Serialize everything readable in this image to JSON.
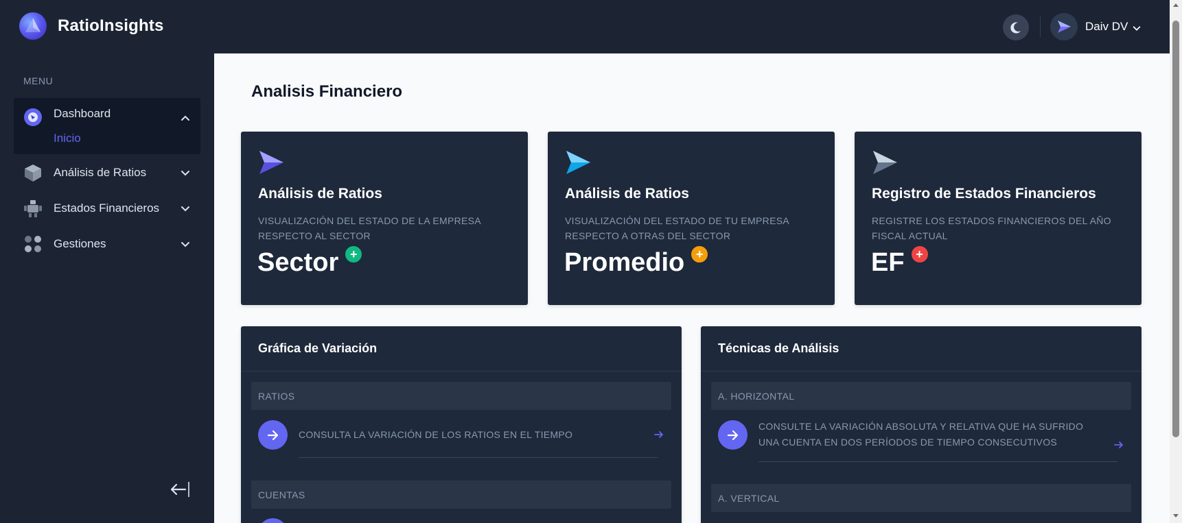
{
  "brand": {
    "name": "RatioInsights"
  },
  "sidebar": {
    "menu_label": "MENU",
    "items": [
      {
        "label": "Dashboard",
        "icon": "dashboard-icon",
        "expanded": true,
        "subitems": [
          {
            "label": "Inicio",
            "active": true
          }
        ]
      },
      {
        "label": "Análisis de Ratios",
        "icon": "cube-icon",
        "expanded": false
      },
      {
        "label": "Estados Financieros",
        "icon": "robot-icon",
        "expanded": false
      },
      {
        "label": "Gestiones",
        "icon": "grid-dots-icon",
        "expanded": false
      }
    ]
  },
  "header": {
    "user_name": "Daiv DV"
  },
  "page": {
    "title": "Analisis Financiero"
  },
  "cards": [
    {
      "title": "Análisis de Ratios",
      "description": "Visualización del estado de la empresa respecto al sector",
      "big": "Sector",
      "badge_color": "#10b981",
      "icon_color": "#7c6cf5"
    },
    {
      "title": "Análisis de Ratios",
      "description": "Visualización del estado de tu empresa respecto a otras del sector",
      "big": "Promedio",
      "badge_color": "#f59e0b",
      "icon_color": "#38bdf8"
    },
    {
      "title": "Registro de Estados Financieros",
      "description": "Registre los estados financieros del año fiscal actual",
      "big": "EF",
      "badge_color": "#ef4444",
      "icon_color": "#94a3b8"
    }
  ],
  "panels": [
    {
      "title": "Gráfica de Variación",
      "sections": [
        {
          "label": "RATIOS",
          "row": "Consulta la variación de los ratios en el tiempo"
        },
        {
          "label": "CUENTAS"
        }
      ]
    },
    {
      "title": "Técnicas de Análisis",
      "sections": [
        {
          "label": "A. HORIZONTAL",
          "row": "Consulte la variación absoluta y relativa que ha sufrido una cuenta en dos períodos de tiempo consecutivos"
        },
        {
          "label": "A. VERTICAL"
        }
      ]
    }
  ],
  "colors": {
    "sidebar_bg": "#1c2434",
    "card_bg": "#1e293b",
    "accent": "#6366f1",
    "page_bg": "#f8fafc"
  }
}
